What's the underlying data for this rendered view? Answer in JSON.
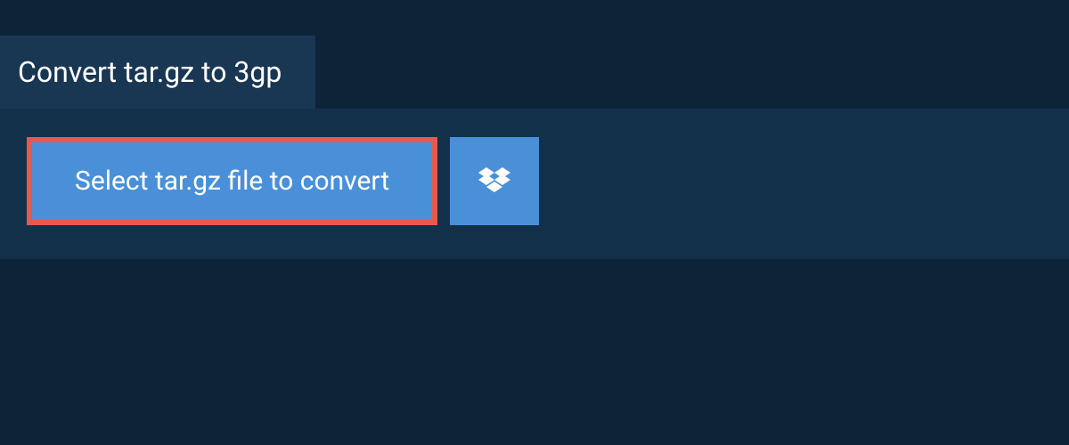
{
  "header": {
    "title": "Convert tar.gz to 3gp"
  },
  "actions": {
    "select_label": "Select tar.gz file to convert"
  },
  "colors": {
    "background": "#0d2438",
    "panel": "#13304a",
    "tab": "#193753",
    "button": "#4a90d9",
    "highlight_border": "#e55a4f"
  }
}
